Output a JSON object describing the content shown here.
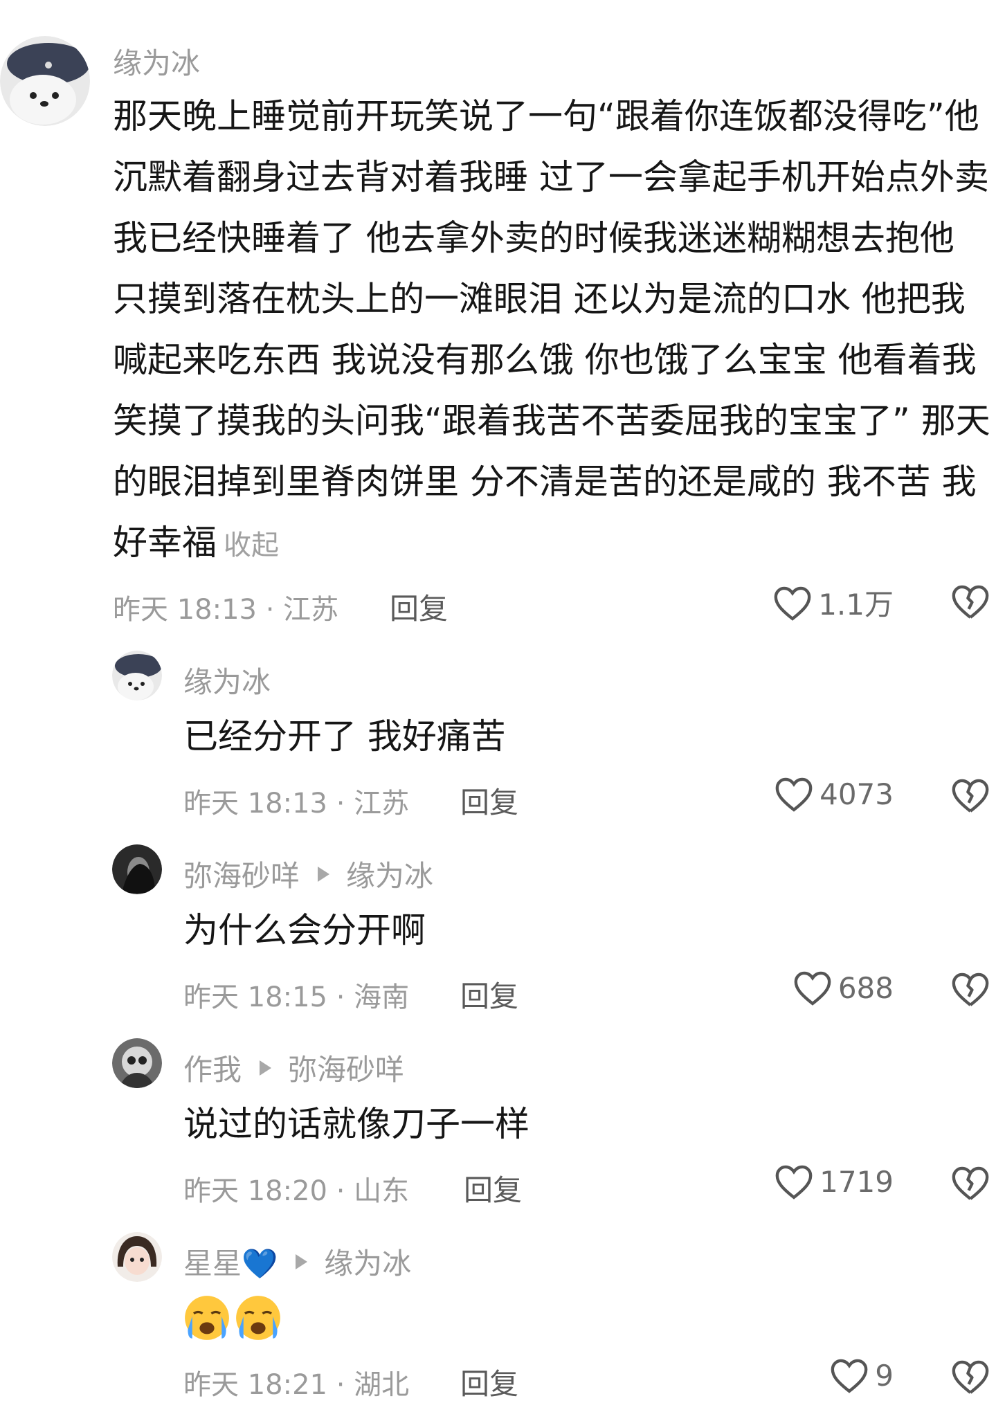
{
  "comments": [
    {
      "author": "缘为冰",
      "text": "那天晚上睡觉前开玩笑说了一句“跟着你连饭都没得吃”他沉默着翻身过去背对着我睡 过了一会拿起手机开始点外卖 我已经快睡着了 他去拿外卖的时候我迷迷糊糊想去抱他 只摸到落在枕头上的一滩眼泪 还以为是流的口水 他把我喊起来吃东西 我说没有那么饿 你也饿了么宝宝 他看着我笑摸了摸我的头问我“跟着我苦不苦委屈我的宝宝了” 那天的眼泪掉到里脊肉饼里 分不清是苦的还是咸的 我不苦 我好幸福",
      "collapse_label": "收起",
      "meta": "昨天 18:13 · 江苏",
      "reply_label": "回复",
      "likes": "1.1万"
    },
    {
      "author": "缘为冰",
      "text": "已经分开了 我好痛苦",
      "meta": "昨天 18:13 · 江苏",
      "reply_label": "回复",
      "likes": "4073"
    },
    {
      "author": "弥海砂咩",
      "reply_to": "缘为冰",
      "text": "为什么会分开啊",
      "meta": "昨天 18:15 · 海南",
      "reply_label": "回复",
      "likes": "688"
    },
    {
      "author": "作我",
      "reply_to": "弥海砂咩",
      "text": "说过的话就像刀子一样",
      "meta": "昨天 18:20 · 山东",
      "reply_label": "回复",
      "likes": "1719"
    },
    {
      "author": "星星💙",
      "reply_to": "缘为冰",
      "text": "",
      "emoji": [
        "crying-face",
        "crying-face"
      ],
      "meta": "昨天 18:21 · 湖北",
      "reply_label": "回复",
      "likes": "9"
    }
  ],
  "colors": {
    "text": "#161616",
    "muted": "#9a9a9a",
    "heart": "#555555"
  }
}
